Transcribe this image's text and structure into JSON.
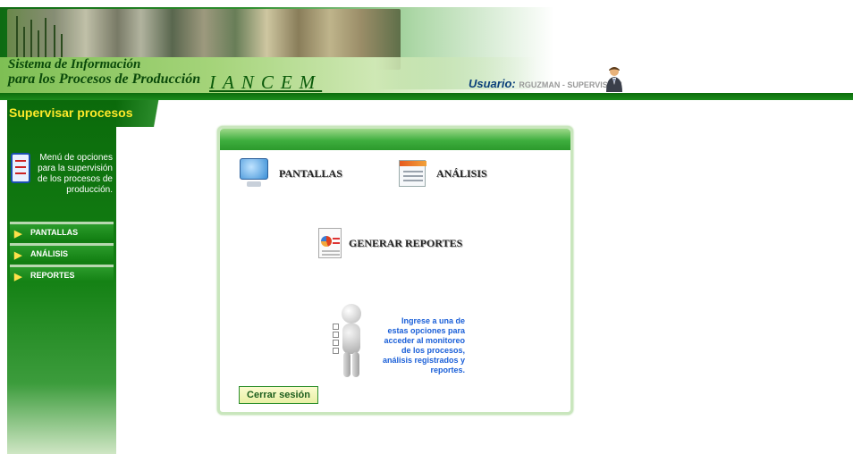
{
  "header": {
    "system_title_line1": "Sistema de Información",
    "system_title_line2": "para los Procesos de Producción",
    "brand": "IANCEM",
    "user_label": "Usuario:",
    "user_value": "RGUZMAN - SUPERVISIÓN"
  },
  "sidebar": {
    "title": "Supervisar procesos",
    "description": "Menú de opciones para la supervisión de los procesos de producción.",
    "items": [
      {
        "label": "PANTALLAS"
      },
      {
        "label": "ANÁLISIS"
      },
      {
        "label": "REPORTES"
      }
    ]
  },
  "main": {
    "options": {
      "pantallas": "PANTALLAS",
      "analisis": "ANÁLISIS",
      "reportes": "GENERAR REPORTES"
    },
    "help_text": "Ingrese a una de estas opciones para acceder al monitoreo de los procesos, análisis registrados y reportes.",
    "logout_label": "Cerrar sesión"
  },
  "colors": {
    "brand_green": "#138013",
    "sidebar_title": "#ffea2a",
    "help_text": "#1a5fd8"
  },
  "icons": [
    "monitor-icon",
    "document-icon",
    "report-icon",
    "user-avatar-icon",
    "checklist-icon",
    "arrow-right-icon",
    "help-figure-icon"
  ]
}
